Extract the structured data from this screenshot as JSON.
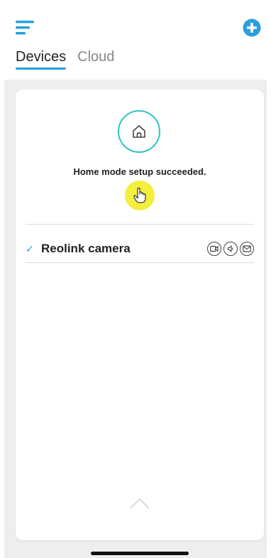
{
  "header": {
    "menu_icon": "hamburger-menu-icon",
    "add_icon": "plus-circle-icon",
    "accent_color": "#2a9ee0",
    "tabs": [
      {
        "label": "Devices",
        "active": true
      },
      {
        "label": "Cloud",
        "active": false
      }
    ]
  },
  "card": {
    "home_icon": "house-icon",
    "message": "Home mode setup succeeded.",
    "device": {
      "name": "Reolink camera",
      "checked": true,
      "status_icons": [
        "video-record-icon",
        "siren-icon",
        "email-icon"
      ]
    },
    "collapse_icon": "chevron-up-icon"
  }
}
